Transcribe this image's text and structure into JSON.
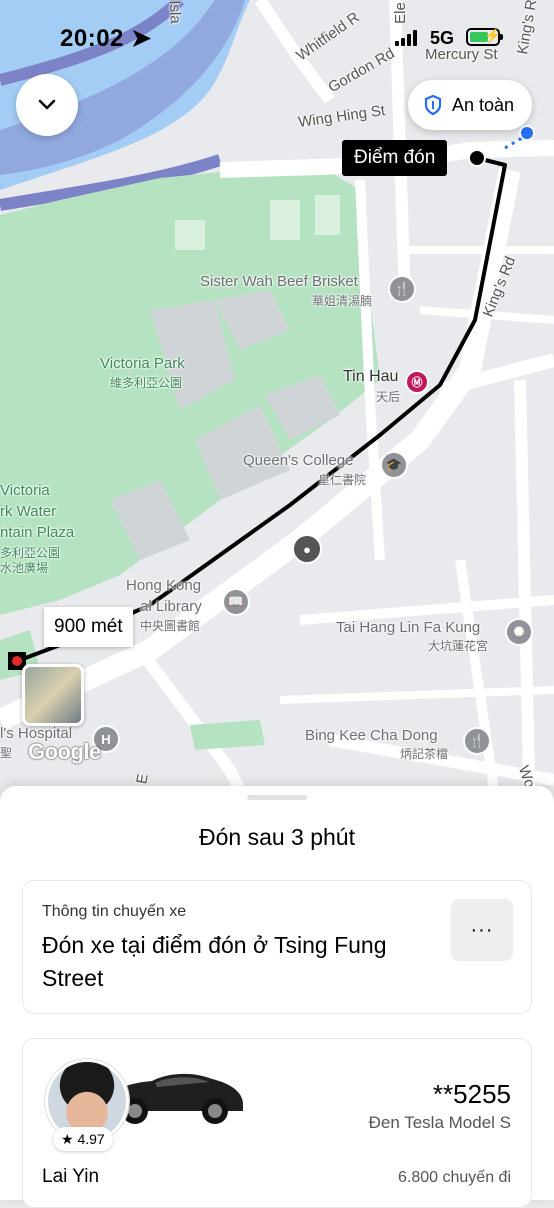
{
  "status_bar": {
    "time": "20:02",
    "network": "5G"
  },
  "map": {
    "labels": {
      "whitfield": "Whitfield R",
      "gordon": "Gordon Rd",
      "mercury": "Mercury St",
      "wing_hing": "Wing Hing St",
      "kings_rd": "King's Rd",
      "kings_rd_top": "King's R",
      "island": "Isla",
      "electric": "Ele",
      "sister_wah": "Sister Wah Beef Brisket",
      "sister_wah_zh": "華姐清湯腩",
      "victoria_park": "Victoria Park",
      "victoria_park_zh": "維多利亞公園",
      "tin_hau": "Tin Hau",
      "tin_hau_zh": "天后",
      "queens_college": "Queen's College",
      "queens_college_zh": "皇仁書院",
      "victoria_plaza_1": "Victoria",
      "victoria_plaza_2": "rk Water",
      "victoria_plaza_3": "ntain Plaza",
      "victoria_plaza_zh1": "多利亞公園",
      "victoria_plaza_zh2": "水池廣場",
      "library_1": "Hong Kong",
      "library_2": "al Library",
      "library_zh": "中央圖書館",
      "tai_hang": "Tai Hang Lin Fa Kung",
      "tai_hang_zh": "大坑蓮花宮",
      "hospital": "l's Hospital",
      "hospital_zh": "聖",
      "bing_kee": "Bing Kee Cha Dong",
      "bing_kee_zh": "炳記茶檔",
      "road_e": "E",
      "road_w": "Wo"
    },
    "pickup_label": "Điểm đón",
    "distance_label": "900 mét",
    "safety_label": "An toàn",
    "google_label": "Google"
  },
  "sheet": {
    "eta": "Đón sau 3 phút",
    "trip_info_label": "Thông tin chuyến xe",
    "trip_info_text": "Đón xe tại điểm đón ở Tsing Fung Street",
    "more_label": "···",
    "plate": "**5255",
    "car_model": "Đen Tesla Model S",
    "rating": "4.97",
    "driver_name": "Lai Yin",
    "trips": "6.800 chuyến đi"
  },
  "colors": {
    "park": "#b5e3c1",
    "water": "#a4cdf5",
    "road": "#ffffff",
    "route": "#000000",
    "accent": "#276ef1"
  }
}
